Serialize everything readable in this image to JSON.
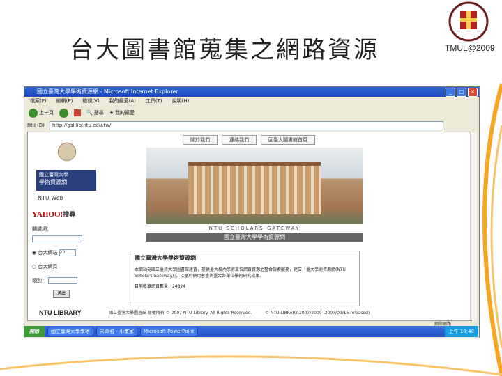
{
  "slide": {
    "title": "台大圖書館蒐集之網路資源",
    "footer_tag": "TMUL@2009"
  },
  "browser": {
    "window_title": "國立臺灣大學學術資源網 - Microsoft Internet Explorer",
    "menu": [
      "檔案(F)",
      "編輯(E)",
      "檢視(V)",
      "我的最愛(A)",
      "工具(T)",
      "說明(H)"
    ],
    "toolbar": {
      "back_label": "上一頁",
      "search_label": "搜尋",
      "favorites_label": "我的最愛"
    },
    "address_label": "網址(D)",
    "address_value": "http://gsl.lib.ntu.edu.tw/",
    "status_right": "網際網路"
  },
  "page": {
    "nav_buttons": [
      "關於我們",
      "連絡我們",
      "回臺大圖書館首頁"
    ],
    "sidebar": {
      "source_title_line1": "國立臺灣大學",
      "source_title_line2": "學術資源網",
      "ntu_web_label": "NTU Web",
      "yahoo_label": "YAHOO!",
      "yahoo_suffix": "搜尋",
      "keyword_label": "關鍵詞：",
      "radio_1": "台大網站",
      "radio_1_select": "20",
      "radio_2": "台大網頁",
      "radio_2_select_label": "類別：",
      "search_button": "送出"
    },
    "banner_caption": "NTU SCHOLARS GATEWAY",
    "banner_title": "國立臺灣大學學術資源網",
    "intro": {
      "heading": "國立臺灣大學學術資源網",
      "body": "本網站為國立臺灣大學圖書館建置，提供臺大校內學術單位網頁資源之整合檢索服務，建立「臺大學術資源網(NTU Scholars Gateway)」，以便利使用者查詢臺大各單位學術研究成果。",
      "count_label": "目前收錄網頁數量：24824"
    },
    "footer": {
      "library": "NTU LIBRARY",
      "copyright": "國立臺灣大學圖書館 版權所有 © 2007 NTU Library. All Rights Reserved.",
      "version": "© NTU LIBRARY 2007/2009 (2007/09/15 released)"
    }
  },
  "taskbar": {
    "start": "開始",
    "tasks": [
      "國立臺灣大學學術",
      "未命名 - 小畫家",
      "Microsoft PowerPoint"
    ],
    "clock": "上午 10:40"
  }
}
